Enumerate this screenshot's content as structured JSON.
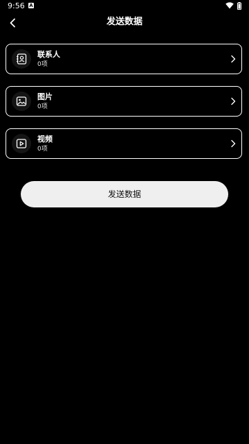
{
  "status_bar": {
    "time": "9:56",
    "notification_glyph": "A",
    "icons": [
      "wifi-icon",
      "battery-icon"
    ]
  },
  "header": {
    "title": "发送数据",
    "back_icon": "chevron-left-icon"
  },
  "items": [
    {
      "label": "联系人",
      "count": "0项",
      "icon": "contacts-icon"
    },
    {
      "label": "图片",
      "count": "0项",
      "icon": "image-icon"
    },
    {
      "label": "视频",
      "count": "0项",
      "icon": "video-icon"
    }
  ],
  "send_button": {
    "label": "发送数据"
  },
  "colors": {
    "background": "#000000",
    "text": "#ffffff",
    "button_bg": "#efefef",
    "button_text": "#111111",
    "card_border": "#ffffff"
  }
}
